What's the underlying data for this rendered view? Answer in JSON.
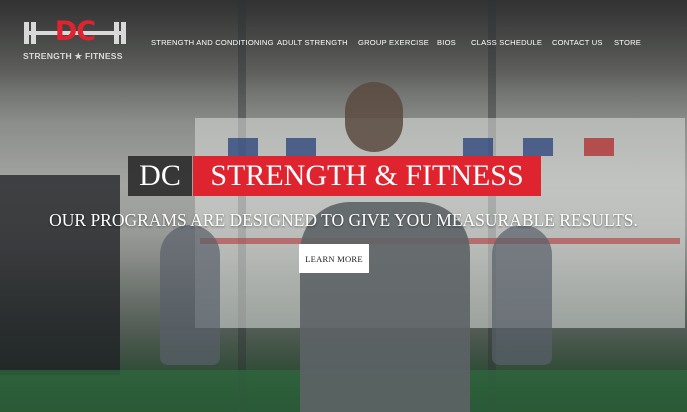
{
  "brand": {
    "monogram": "DC",
    "wordmark": "STRENGTH ★ FITNESS",
    "accent_color": "#e0242f"
  },
  "nav": {
    "items": [
      "STRENGTH AND CONDITIONING",
      "ADULT STRENGTH",
      "GROUP EXERCISE",
      "BIOS",
      "CLASS SCHEDULE",
      "CONTACT US",
      "STORE"
    ]
  },
  "hero": {
    "title_left": "DC",
    "title_right": "STRENGTH & FITNESS",
    "subtitle": "OUR PROGRAMS ARE DESIGNED TO GIVE YOU MEASURABLE RESULTS.",
    "cta_label": "LEARN MORE"
  }
}
